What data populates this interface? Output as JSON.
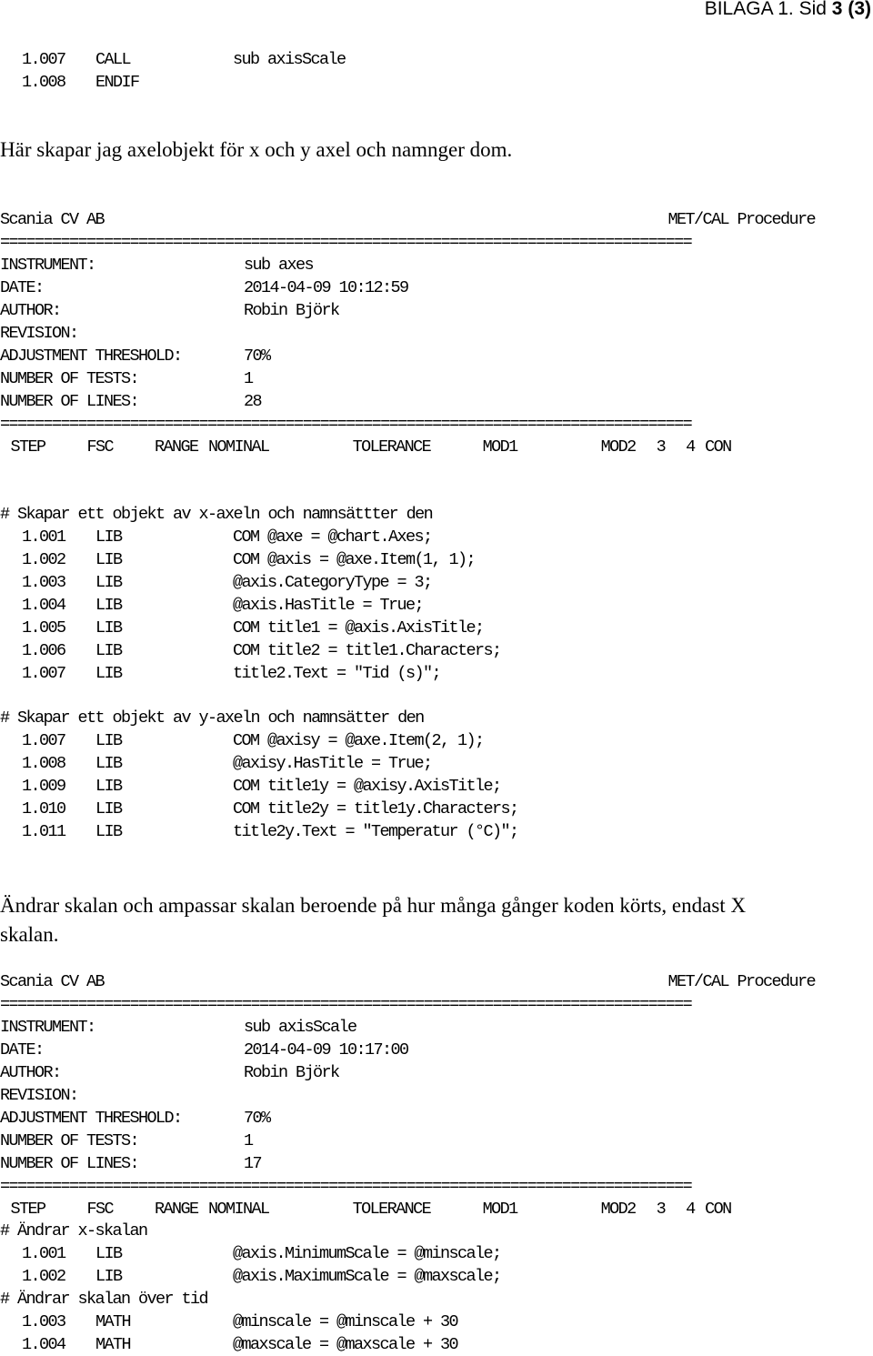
{
  "page_header": {
    "prefix": "BILAGA 1. Sid ",
    "page": "3",
    "total": "(3)"
  },
  "top_code": [
    {
      "step": "1.007",
      "fsc": "CALL",
      "code": "sub axisScale"
    },
    {
      "step": "1.008",
      "fsc": "ENDIF",
      "code": ""
    }
  ],
  "paragraph_1": "Här skapar jag axelobjekt för x och y axel och namnger dom.",
  "procedure_1": {
    "company": "Scania CV AB",
    "type": "MET/CAL Procedure",
    "rule": "================================================================================",
    "fields": [
      {
        "label": "INSTRUMENT:",
        "value": "sub axes"
      },
      {
        "label": "DATE:",
        "value": "2014-04-09 10:12:59"
      },
      {
        "label": "AUTHOR:",
        "value": "Robin Björk"
      },
      {
        "label": "REVISION:",
        "value": ""
      },
      {
        "label": "ADJUSTMENT THRESHOLD:",
        "value": "70%"
      },
      {
        "label": "NUMBER OF TESTS:",
        "value": "1"
      },
      {
        "label": "NUMBER OF LINES:",
        "value": "28"
      }
    ],
    "columns": " STEP    FSC    RANGE NOMINAL        TOLERANCE     MOD1        MOD2  3  4 CON",
    "comment_1": "# Skapar ett objekt av x-axeln och namnsättter den",
    "block_1": [
      {
        "step": "1.001",
        "fsc": "LIB",
        "code": "COM @axe = @chart.Axes;"
      },
      {
        "step": "1.002",
        "fsc": "LIB",
        "code": "COM @axis = @axe.Item(1, 1);"
      },
      {
        "step": "1.003",
        "fsc": "LIB",
        "code": "@axis.CategoryType = 3;"
      },
      {
        "step": "1.004",
        "fsc": "LIB",
        "code": "@axis.HasTitle = True;"
      },
      {
        "step": "1.005",
        "fsc": "LIB",
        "code": "COM title1 = @axis.AxisTitle;"
      },
      {
        "step": "1.006",
        "fsc": "LIB",
        "code": "COM title2 = title1.Characters;"
      },
      {
        "step": "1.007",
        "fsc": "LIB",
        "code": "title2.Text = \"Tid (s)\";"
      }
    ],
    "comment_2": "# Skapar ett objekt av y-axeln och namnsätter den",
    "block_2": [
      {
        "step": "1.007",
        "fsc": "LIB",
        "code": "COM @axisy = @axe.Item(2, 1);"
      },
      {
        "step": "1.008",
        "fsc": "LIB",
        "code": "@axisy.HasTitle = True;"
      },
      {
        "step": "1.009",
        "fsc": "LIB",
        "code": "COM title1y = @axisy.AxisTitle;"
      },
      {
        "step": "1.010",
        "fsc": "LIB",
        "code": "COM title2y = title1y.Characters;"
      },
      {
        "step": "1.011",
        "fsc": "LIB",
        "code": "title2y.Text = \"Temperatur (°C)\";"
      }
    ]
  },
  "paragraph_2_line_1": "Ändrar skalan och ampassar skalan beroende på hur många gånger koden körts, endast X",
  "paragraph_2_line_2": "skalan.",
  "procedure_2": {
    "company": "Scania CV AB",
    "type": "MET/CAL Procedure",
    "rule": "================================================================================",
    "fields": [
      {
        "label": "INSTRUMENT:",
        "value": "sub axisScale"
      },
      {
        "label": "DATE:",
        "value": "2014-04-09 10:17:00"
      },
      {
        "label": "AUTHOR:",
        "value": "Robin Björk"
      },
      {
        "label": "REVISION:",
        "value": ""
      },
      {
        "label": "ADJUSTMENT THRESHOLD:",
        "value": "70%"
      },
      {
        "label": "NUMBER OF TESTS:",
        "value": "1"
      },
      {
        "label": "NUMBER OF LINES:",
        "value": "17"
      }
    ],
    "columns": " STEP    FSC    RANGE NOMINAL        TOLERANCE     MOD1        MOD2  3  4 CON",
    "comment_1": "# Ändrar x-skalan",
    "block_1": [
      {
        "step": "1.001",
        "fsc": "LIB",
        "code": "@axis.MinimumScale = @minscale;"
      },
      {
        "step": "1.002",
        "fsc": "LIB",
        "code": "@axis.MaximumScale = @maxscale;"
      }
    ],
    "comment_2": "# Ändrar skalan över tid",
    "block_2": [
      {
        "step": "1.003",
        "fsc": "MATH",
        "code": "@minscale = @minscale + 30"
      },
      {
        "step": "1.004",
        "fsc": "MATH",
        "code": "@maxscale = @maxscale + 30"
      }
    ]
  }
}
